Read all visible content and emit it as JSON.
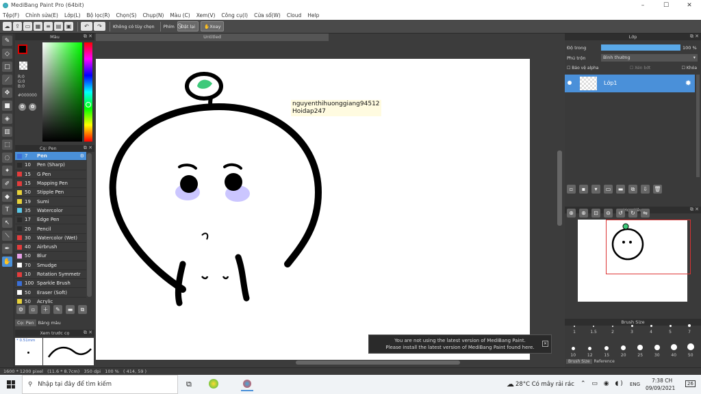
{
  "app": {
    "title": "MediBang Paint Pro (64bit)"
  },
  "window_controls": {
    "minimize": "–",
    "maximize": "☐",
    "close": "✕"
  },
  "menu": [
    "Tệp(F)",
    "Chỉnh sửa(E)",
    "Lớp(L)",
    "Bộ lọc(R)",
    "Chọn(S)",
    "Chụp(N)",
    "Màu (C)",
    "Xem(V)",
    "Công cụ(I)",
    "Cửa sổ(W)",
    "Cloud",
    "Help"
  ],
  "toolbar": {
    "snap_label": "Không có tùy chọn",
    "snap_prefix": "Phím",
    "pill1": "Đặt lại",
    "pill2": "Xoay"
  },
  "color_panel": {
    "title": "Màu",
    "r": "R:0",
    "g": "G:0",
    "b": "B:0",
    "hex": "#000000"
  },
  "brush_panel": {
    "title": "Cọ: Pen",
    "tabs": [
      "Cọ: Pen",
      "Bảng màu"
    ],
    "items": [
      {
        "size": "7",
        "name": "Pen",
        "color": "#3a6fd8"
      },
      {
        "size": "10",
        "name": "Pen (Sharp)",
        "color": "#2b2b2b"
      },
      {
        "size": "15",
        "name": "G Pen",
        "color": "#e33c3c"
      },
      {
        "size": "15",
        "name": "Mapping Pen",
        "color": "#e33c3c"
      },
      {
        "size": "50",
        "name": "Stipple Pen",
        "color": "#e8d23a"
      },
      {
        "size": "19",
        "name": "Sumi",
        "color": "#e8d23a"
      },
      {
        "size": "35",
        "name": "Watercolor",
        "color": "#5ac8e8"
      },
      {
        "size": "17",
        "name": "Edge Pen",
        "color": "#2b2b2b"
      },
      {
        "size": "20",
        "name": "Pencil",
        "color": "#2b2b2b"
      },
      {
        "size": "30",
        "name": "Watercolor (Wet)",
        "color": "#e33c3c"
      },
      {
        "size": "40",
        "name": "Airbrush",
        "color": "#e33c3c"
      },
      {
        "size": "50",
        "name": "Blur",
        "color": "#e8a0e8"
      },
      {
        "size": "70",
        "name": "Smudge",
        "color": "#ffffff"
      },
      {
        "size": "10",
        "name": "Rotation Symmetr",
        "color": "#e33c3c"
      },
      {
        "size": "100",
        "name": "Sparkle Brush",
        "color": "#3a6fd8"
      },
      {
        "size": "50",
        "name": "Eraser (Soft)",
        "color": "#ffffff"
      },
      {
        "size": "50",
        "name": "Acrylic",
        "color": "#e8d23a"
      }
    ]
  },
  "preview_panel": {
    "title": "Xem trước cọ",
    "size": "0.51mm"
  },
  "canvas": {
    "tab_title": "Untitled",
    "watermark_line1": "nguyenthihuonggiang94512",
    "watermark_line2": "Hoidap247"
  },
  "layer_panel": {
    "title": "Lớp",
    "opacity_label": "Độ trong",
    "opacity_value": "100 %",
    "opacity": 1.0,
    "blend_label": "Phủ trộn",
    "blend_value": "Bình thường",
    "protect_alpha": "Bảo vệ alpha",
    "clipping": "Xén bớt",
    "lock": "Khóa",
    "layer_name": "Lớp1"
  },
  "navigator": {
    "title": "Hoa tiêu"
  },
  "brush_size": {
    "title": "Brush Size",
    "labels": [
      "1",
      "1.5",
      "2",
      "3",
      "4",
      "5",
      "7",
      "10",
      "12",
      "15",
      "20",
      "25",
      "30",
      "40",
      "50"
    ],
    "tabs": [
      "Brush Size",
      "Reference"
    ]
  },
  "notice": {
    "line1": "You are not using the latest version of MediBang Paint.",
    "line2": "Please install the latest version of MediBang Paint found here.",
    "close": "✕"
  },
  "status": {
    "text": "1600 * 1200 pixel   (11.6 * 8.7cm)   350 dpi   100 %   ( 414, 59 )"
  },
  "taskbar": {
    "search_placeholder": "Nhập tại đây để tìm kiếm",
    "weather": "28°C  Có mây rải rác",
    "lang": "ENG",
    "time": "7:38 CH",
    "date": "09/09/2021",
    "badge": "26"
  }
}
